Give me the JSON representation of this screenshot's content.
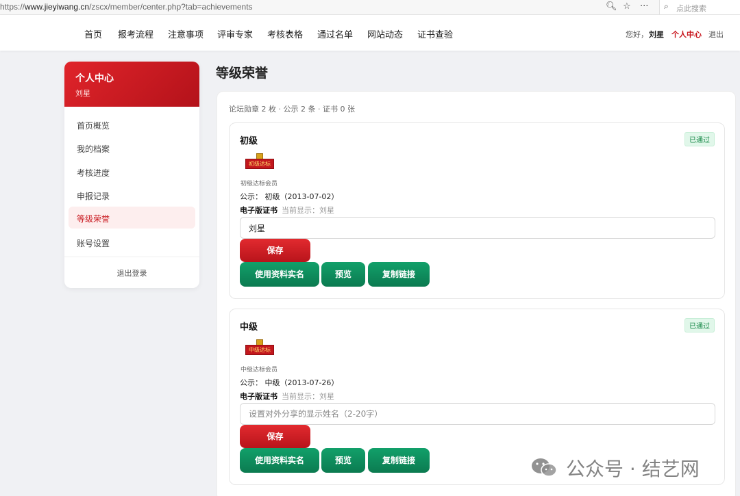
{
  "browser": {
    "url_prefix": "https://",
    "url_host": "www.jieyiwang.cn",
    "url_path": "/zscx/member/center.php?tab=achievements",
    "search_placeholder": "点此搜索"
  },
  "nav": {
    "items": [
      "首页",
      "报考流程",
      "注意事项",
      "评审专家",
      "考核表格",
      "通过名单",
      "网站动态",
      "证书查验"
    ],
    "greeting": "您好，",
    "username": "刘星",
    "center": "个人中心",
    "logout": "退出"
  },
  "sidebar": {
    "title": "个人中心",
    "subtitle": "刘星",
    "items": [
      "首页概览",
      "我的档案",
      "考核进度",
      "申报记录",
      "等级荣誉",
      "账号设置"
    ],
    "active_index": 4,
    "logout": "退出登录"
  },
  "main": {
    "title": "等级荣誉",
    "summary": "论坛勋章 2 枚 · 公示 2 条 · 证书 0 张",
    "cards": [
      {
        "title": "初级",
        "status": "已通过",
        "medal_text": "初级达标",
        "medal_label": "初级达标会员",
        "publicity": "公示：  初级（2013-07-02）",
        "cert_label": "电子版证书",
        "cert_current": "当前显示：刘星",
        "input_value": "刘星",
        "input_placeholder": "设置对外分享的显示姓名（2-20字）",
        "save": "保存",
        "use_realname": "使用资料实名",
        "preview": "预览",
        "copy_link": "复制链接"
      },
      {
        "title": "中级",
        "status": "已通过",
        "medal_text": "中级达标",
        "medal_label": "中级达标会员",
        "publicity": "公示：  中级（2013-07-26）",
        "cert_label": "电子版证书",
        "cert_current": "当前显示：刘星",
        "input_value": "",
        "input_placeholder": "设置对外分享的显示姓名（2-20字）",
        "save": "保存",
        "use_realname": "使用资料实名",
        "preview": "预览",
        "copy_link": "复制链接"
      }
    ]
  },
  "watermark": "公众号 · 结艺网",
  "colors": {
    "brand_red": "#c8161d",
    "green": "#0f8c5c",
    "badge_green": "#1a8a4a"
  }
}
